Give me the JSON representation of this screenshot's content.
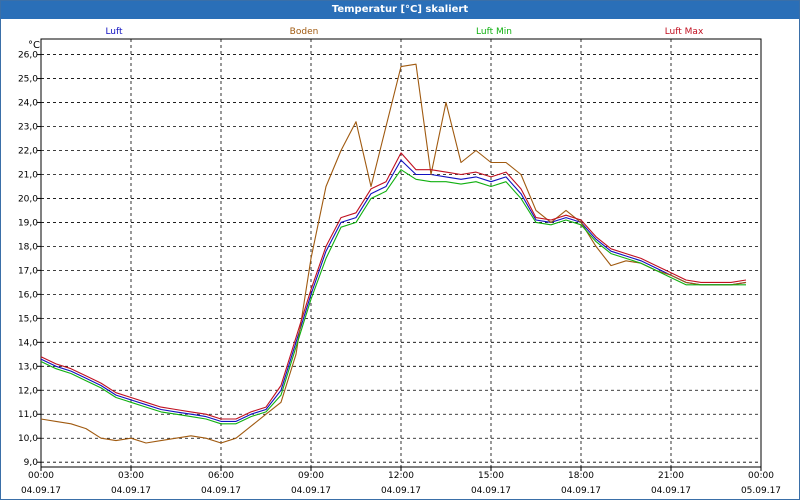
{
  "window": {
    "title": "Temperatur [°C] skaliert"
  },
  "chart_data": {
    "type": "line",
    "title": "Temperatur [°C] skaliert",
    "ylabel": "°C",
    "ylim": [
      9.0,
      26.0
    ],
    "yticks": [
      "26,0",
      "25,0",
      "24,0",
      "23,0",
      "22,0",
      "21,0",
      "20,0",
      "19,0",
      "18,0",
      "17,0",
      "16,0",
      "15,0",
      "14,0",
      "13,0",
      "12,0",
      "11,0",
      "10,0",
      "9,0"
    ],
    "xlim_hours": [
      0,
      24
    ],
    "xticks": [
      {
        "time": "00:00",
        "date": "04.09.17"
      },
      {
        "time": "03:00",
        "date": "04.09.17"
      },
      {
        "time": "06:00",
        "date": "04.09.17"
      },
      {
        "time": "09:00",
        "date": "04.09.17"
      },
      {
        "time": "12:00",
        "date": "04.09.17"
      },
      {
        "time": "15:00",
        "date": "04.09.17"
      },
      {
        "time": "18:00",
        "date": "04.09.17"
      },
      {
        "time": "21:00",
        "date": "04.09.17"
      },
      {
        "time": "00:00",
        "date": "05.09.17"
      }
    ],
    "grid": true,
    "legend": "top",
    "series": [
      {
        "name": "Luft",
        "color": "#1010c0",
        "x": [
          0,
          0.5,
          1,
          1.5,
          2,
          2.5,
          3,
          3.5,
          4,
          4.5,
          5,
          5.5,
          6,
          6.5,
          7,
          7.5,
          8,
          8.5,
          9,
          9.5,
          10,
          10.5,
          11,
          11.5,
          12,
          12.5,
          13,
          13.5,
          14,
          14.5,
          15,
          15.5,
          16,
          16.5,
          17,
          17.5,
          18,
          18.5,
          19,
          19.5,
          20,
          20.5,
          21,
          21.5,
          22,
          22.5,
          23,
          23.5
        ],
        "values": [
          13.3,
          13.0,
          12.8,
          12.5,
          12.2,
          11.8,
          11.6,
          11.4,
          11.2,
          11.1,
          11.0,
          10.9,
          10.7,
          10.7,
          11.0,
          11.2,
          12.0,
          14.0,
          16.0,
          17.8,
          19.0,
          19.2,
          20.2,
          20.5,
          21.6,
          21.0,
          21.0,
          20.9,
          20.8,
          20.9,
          20.7,
          20.9,
          20.2,
          19.1,
          19.0,
          19.2,
          19.0,
          18.3,
          17.8,
          17.6,
          17.4,
          17.1,
          16.8,
          16.5,
          16.4,
          16.4,
          16.4,
          16.5
        ]
      },
      {
        "name": "Boden",
        "color": "#a05a10",
        "x": [
          0,
          0.5,
          1,
          1.5,
          2,
          2.5,
          3,
          3.5,
          4,
          4.5,
          5,
          5.5,
          6,
          6.5,
          7,
          7.5,
          8,
          8.5,
          9,
          9.5,
          10,
          10.5,
          11,
          11.5,
          12,
          12.5,
          13,
          13.5,
          14,
          14.5,
          15,
          15.5,
          16,
          16.5,
          17,
          17.5,
          18,
          18.5,
          19,
          19.5,
          20,
          20.5,
          21,
          21.5,
          22,
          22.5,
          23,
          23.5
        ],
        "values": [
          10.8,
          10.7,
          10.6,
          10.4,
          10.0,
          9.9,
          10.0,
          9.8,
          9.9,
          10.0,
          10.1,
          10.0,
          9.8,
          10.0,
          10.5,
          11.0,
          11.5,
          13.5,
          17.5,
          20.5,
          22.0,
          23.2,
          20.5,
          23.0,
          25.5,
          25.6,
          21.0,
          24.0,
          21.5,
          22.0,
          21.5,
          21.5,
          21.0,
          19.5,
          19.0,
          19.5,
          19.0,
          18.0,
          17.2,
          17.4,
          17.3,
          17.0,
          16.8,
          16.5,
          16.4,
          16.4,
          16.4,
          16.5
        ]
      },
      {
        "name": "Luft Min",
        "color": "#10b010",
        "x": [
          0,
          0.5,
          1,
          1.5,
          2,
          2.5,
          3,
          3.5,
          4,
          4.5,
          5,
          5.5,
          6,
          6.5,
          7,
          7.5,
          8,
          8.5,
          9,
          9.5,
          10,
          10.5,
          11,
          11.5,
          12,
          12.5,
          13,
          13.5,
          14,
          14.5,
          15,
          15.5,
          16,
          16.5,
          17,
          17.5,
          18,
          18.5,
          19,
          19.5,
          20,
          20.5,
          21,
          21.5,
          22,
          22.5,
          23,
          23.5
        ],
        "values": [
          13.2,
          12.9,
          12.7,
          12.4,
          12.1,
          11.7,
          11.5,
          11.3,
          11.1,
          11.0,
          10.9,
          10.8,
          10.6,
          10.6,
          10.9,
          11.1,
          11.8,
          13.8,
          15.8,
          17.5,
          18.8,
          19.0,
          20.0,
          20.3,
          21.2,
          20.8,
          20.7,
          20.7,
          20.6,
          20.7,
          20.5,
          20.7,
          20.0,
          19.0,
          18.9,
          19.1,
          18.9,
          18.2,
          17.7,
          17.5,
          17.3,
          17.0,
          16.7,
          16.4,
          16.4,
          16.4,
          16.4,
          16.4
        ]
      },
      {
        "name": "Luft Max",
        "color": "#c01020",
        "x": [
          0,
          0.5,
          1,
          1.5,
          2,
          2.5,
          3,
          3.5,
          4,
          4.5,
          5,
          5.5,
          6,
          6.5,
          7,
          7.5,
          8,
          8.5,
          9,
          9.5,
          10,
          10.5,
          11,
          11.5,
          12,
          12.5,
          13,
          13.5,
          14,
          14.5,
          15,
          15.5,
          16,
          16.5,
          17,
          17.5,
          18,
          18.5,
          19,
          19.5,
          20,
          20.5,
          21,
          21.5,
          22,
          22.5,
          23,
          23.5
        ],
        "values": [
          13.4,
          13.1,
          12.9,
          12.6,
          12.3,
          11.9,
          11.7,
          11.5,
          11.3,
          11.2,
          11.1,
          11.0,
          10.8,
          10.8,
          11.1,
          11.3,
          12.2,
          14.2,
          16.2,
          18.0,
          19.2,
          19.4,
          20.4,
          20.7,
          21.9,
          21.2,
          21.2,
          21.1,
          21.0,
          21.1,
          20.9,
          21.1,
          20.4,
          19.2,
          19.1,
          19.3,
          19.1,
          18.4,
          17.9,
          17.7,
          17.5,
          17.2,
          16.9,
          16.6,
          16.5,
          16.5,
          16.5,
          16.6
        ]
      }
    ]
  }
}
